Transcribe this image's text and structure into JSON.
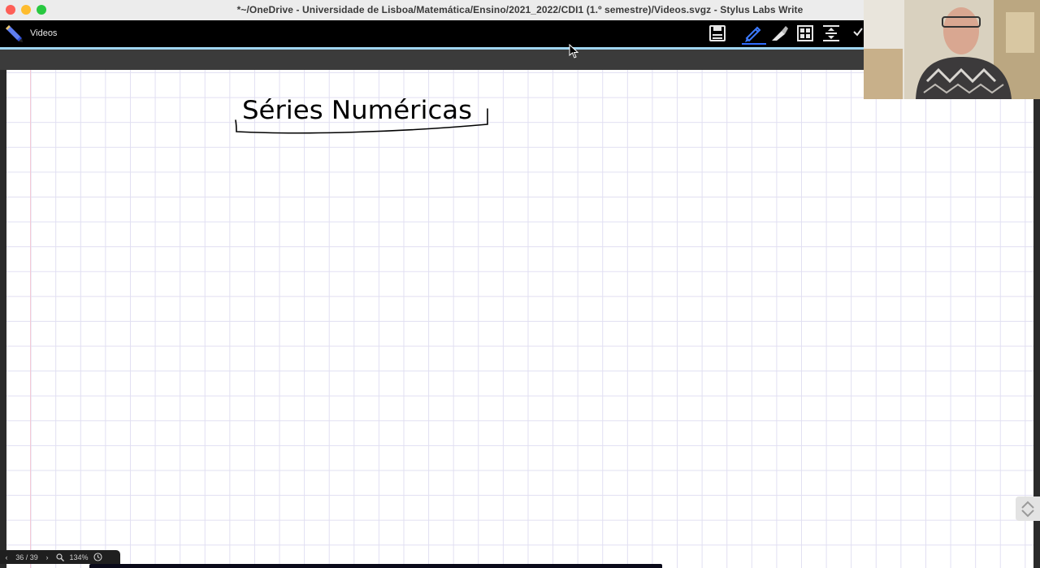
{
  "window": {
    "title": "*~/OneDrive - Universidade de Lisboa/Matemática/Ensino/2021_2022/CDI1 (1.º semestre)/Videos.svgz - Stylus Labs Write",
    "traffic_lights": {
      "close_color": "#fe5f57",
      "minimize_color": "#febc2e",
      "zoom_color": "#28c840"
    }
  },
  "toolbar": {
    "document_name": "Videos",
    "tools": [
      {
        "name": "save-icon"
      },
      {
        "name": "pen-icon",
        "active": true
      },
      {
        "name": "eraser-icon"
      },
      {
        "name": "select-grid-icon"
      },
      {
        "name": "insert-space-icon"
      },
      {
        "name": "overflow-icon"
      }
    ],
    "active_tool_color": "#2f6cff"
  },
  "canvas": {
    "handwritten_title": "Séries Numéricas",
    "ruling": "grid",
    "grid_color": "#e1dff2",
    "margin_color": "#f3c9d6"
  },
  "bottombar": {
    "prev_page_label": "‹",
    "page_indicator": "36 / 39",
    "next_page_label": "›",
    "zoom_level": "134%"
  }
}
